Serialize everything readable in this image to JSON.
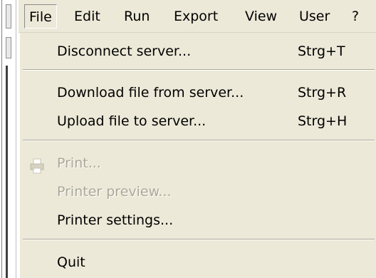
{
  "menubar": {
    "items": [
      {
        "label": "File"
      },
      {
        "label": "Edit"
      },
      {
        "label": "Run"
      },
      {
        "label": "Export"
      },
      {
        "label": "View"
      },
      {
        "label": "User"
      },
      {
        "label": "?"
      }
    ]
  },
  "file_menu": {
    "items": [
      {
        "label": "Disconnect server...",
        "shortcut": "Strg+T"
      },
      {
        "label": "Download file from server...",
        "shortcut": "Strg+R"
      },
      {
        "label": "Upload file to server...",
        "shortcut": "Strg+H"
      },
      {
        "label": "Print..."
      },
      {
        "label": "Printer preview..."
      },
      {
        "label": "Printer settings..."
      },
      {
        "label": "Quit"
      }
    ]
  },
  "icons": {
    "print_icon": "printer-icon"
  },
  "colors": {
    "menu_bg": "#ece9d8",
    "disabled_text": "#aca899",
    "separator": "#aca899"
  }
}
